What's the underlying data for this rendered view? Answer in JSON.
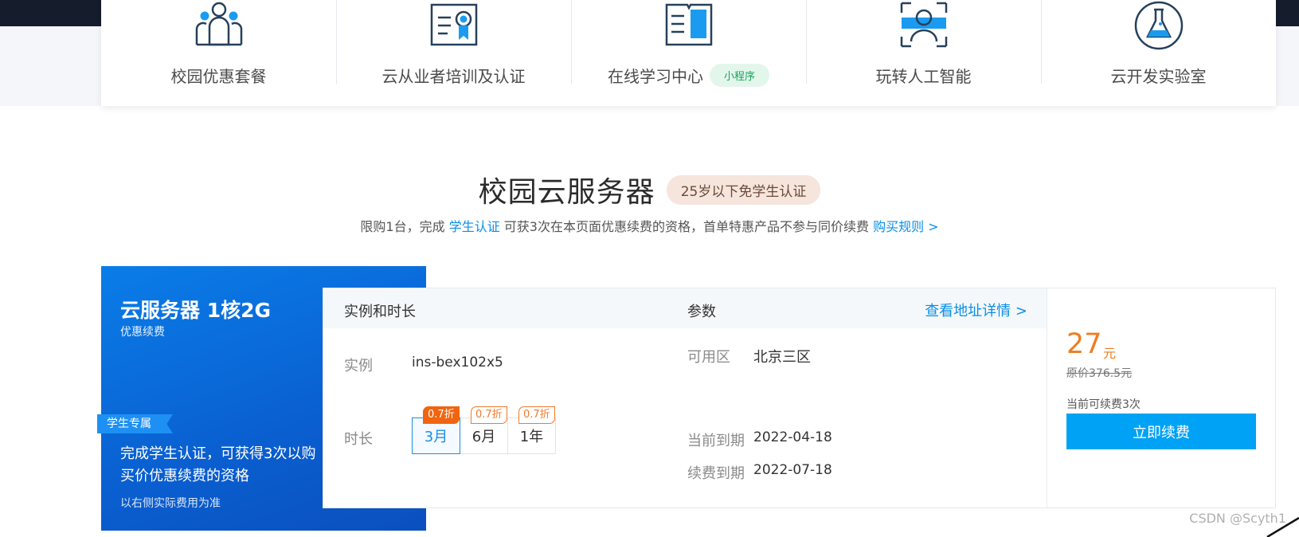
{
  "nav": {
    "items": [
      {
        "label": "校园优惠套餐",
        "icon": "people-group-icon"
      },
      {
        "label": "云从业者培训及认证",
        "icon": "certificate-icon"
      },
      {
        "label": "在线学习中心",
        "icon": "book-icon",
        "badge": "小程序"
      },
      {
        "label": "玩转人工智能",
        "icon": "face-scan-icon"
      },
      {
        "label": "云开发实验室",
        "icon": "flask-icon"
      }
    ]
  },
  "section": {
    "title": "校园云服务器",
    "age_badge": "25岁以下免学生认证",
    "subtitle_pre": "限购1台，完成 ",
    "subtitle_link1": "学生认证",
    "subtitle_mid": " 可获3次在本页面优惠续费的资格，首单特惠产品不参与同价续费 ",
    "subtitle_link2": "购买规则 >"
  },
  "product": {
    "title": "云服务器 1核2G",
    "subtitle": "优惠续费",
    "student_tag": "学生专属",
    "desc": "完成学生认证，可获得3次以购买价优惠续费的资格",
    "note": "以右侧实际费用为准"
  },
  "detail": {
    "header_instance": "实例和时长",
    "header_params": "参数",
    "header_link": "查看地址详情 >",
    "instance_label": "实例",
    "instance_value": "ins-bex102x5",
    "duration_label": "时长",
    "durations": [
      {
        "label": "3月",
        "discount": "0.7折",
        "active": true
      },
      {
        "label": "6月",
        "discount": "0.7折",
        "active": false
      },
      {
        "label": "1年",
        "discount": "0.7折",
        "active": false
      }
    ],
    "zone_label": "可用区",
    "zone_value": "北京三区",
    "current_expiry_label": "当前到期",
    "current_expiry_value": "2022-04-18",
    "renew_expiry_label": "续费到期",
    "renew_expiry_value": "2022-07-18"
  },
  "price": {
    "amount": "27",
    "unit": "元",
    "original": "原价376.5元",
    "renew_count": "当前可续费3次",
    "button": "立即续费"
  },
  "watermark": "CSDN @Scyth1",
  "colors": {
    "accent": "#0a8fe6",
    "price": "#ef7d1f",
    "button": "#00a2f5",
    "dark_bar": "#151c2b"
  }
}
